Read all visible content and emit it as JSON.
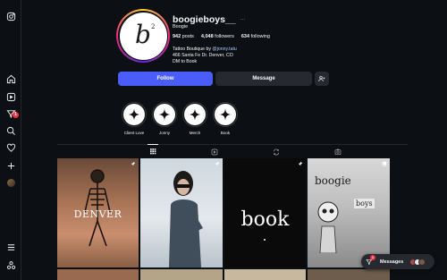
{
  "profile": {
    "username": "boogieboys__",
    "more_label": "···",
    "full_name": "Boogie",
    "posts_count": "942",
    "posts_label": "posts",
    "followers_count": "4,048",
    "followers_label": "followers",
    "following_count": "634",
    "following_label": "following",
    "bio_line1_prefix": "Tattoo Boutique by ",
    "bio_line1_link": "@jonny.tatu",
    "bio_line2": "466 Santa Fe Dr. Denver, CO",
    "bio_line3": "DM to Book",
    "avatar_letter": "b",
    "avatar_superscript": "2"
  },
  "actions": {
    "follow_label": "Follow",
    "message_label": "Message"
  },
  "highlights": [
    {
      "label": "Client Love"
    },
    {
      "label": "Jonny"
    },
    {
      "label": "Merch"
    },
    {
      "label": "Book"
    }
  ],
  "tiles": {
    "denver_text": "DENVER",
    "book_text": "book",
    "boogie_text": "boogie",
    "boys_text": "boys"
  },
  "sidebar": {
    "notifications_badge": "1"
  },
  "messages_bar": {
    "label": "Messages",
    "badge": "1"
  },
  "colors": {
    "background": "#0c1014",
    "follow_button": "#4a5df9",
    "secondary_button": "#262a30",
    "badge": "#ff3040"
  }
}
